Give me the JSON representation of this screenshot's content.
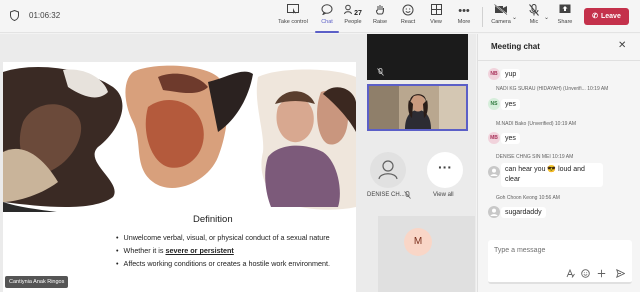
{
  "toolbar": {
    "timer": "01:06:32",
    "take_control": "Take control",
    "chat": "Chat",
    "people": "People",
    "people_count": "27",
    "raise": "Raise",
    "react": "React",
    "view": "View",
    "more": "More",
    "camera": "Camera",
    "mic": "Mic",
    "share": "Share",
    "leave": "Leave",
    "accent": "#5b5fc7",
    "leave_color": "#c4314b"
  },
  "slide": {
    "title": "Definition",
    "bullets": {
      "b1": "Unwelcome verbal, visual, or physical conduct of a sexual nature",
      "b2_prefix": "Whether it is ",
      "b2_bold": "severe or persistent",
      "b3": "Affects working conditions or creates a hostile work environment."
    }
  },
  "presenter_name": "Cantiynia Anak Ringos",
  "participants": {
    "denise_name": "DENISE CH...",
    "view_all": "View all",
    "m_initial": "M"
  },
  "chat": {
    "title": "Meeting chat",
    "messages": [
      {
        "initials": "NB",
        "author": "",
        "time": "",
        "text": "yup",
        "avatar_bg": "#f1d3dc",
        "avatar_fg": "#a8325a"
      },
      {
        "initials": "NS",
        "author": "NADI KG SURAU (HIDAYAH) (Unverifi...",
        "time": "10:19 AM",
        "text": "yes",
        "avatar_bg": "#d6eedb",
        "avatar_fg": "#2f7a3e"
      },
      {
        "initials": "MB",
        "author": "M.NADI Bako (Unverified)",
        "time": "10:19 AM",
        "text": "yes",
        "avatar_bg": "#f1d3dc",
        "avatar_fg": "#a8325a"
      },
      {
        "initials": "",
        "author": "DENISE CHNG SIN MEI",
        "time": "10:19 AM",
        "text_line1": "can hear you 😎 loud and",
        "text_line2": "clear",
        "avatar_bg": "#c8c8c8",
        "avatar_fg": "#fff"
      },
      {
        "initials": "",
        "author": "Goh Choon Keong",
        "time": "10:56 AM",
        "text": "sugardaddy",
        "avatar_bg": "#c8c8c8",
        "avatar_fg": "#fff"
      }
    ],
    "input_placeholder": "Type a message"
  }
}
